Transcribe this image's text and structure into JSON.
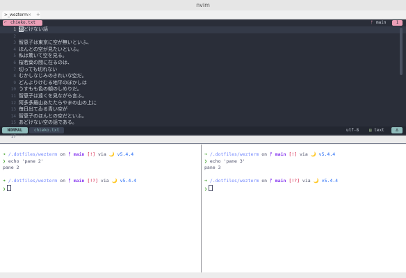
{
  "window": {
    "title": "nvim"
  },
  "tabs": [
    {
      "icon": ">_",
      "label": "wezterm",
      "close": "×"
    }
  ],
  "new_tab": "+",
  "nvim": {
    "buffer_tab": {
      "icon": "⌐",
      "name": "chieko.txt"
    },
    "git_branch": {
      "icon": "ᚠ",
      "name": "main"
    },
    "tab_number": "1",
    "lines": [
      {
        "n": "1",
        "text": "あどけない話",
        "current": true
      },
      {
        "n": "2",
        "text": ""
      },
      {
        "n": "3",
        "text": "智恵子は東京に空が無いといふ、"
      },
      {
        "n": "4",
        "text": "ほんとの空が見たいといふ。"
      },
      {
        "n": "5",
        "text": "私は驚いて空を見る。"
      },
      {
        "n": "6",
        "text": "桜若葉の間に在るのは、"
      },
      {
        "n": "7",
        "text": "切っても切れない"
      },
      {
        "n": "8",
        "text": "むかしなじみのきれいな空だ。"
      },
      {
        "n": "9",
        "text": "どんよりけむる地平のぼかしは"
      },
      {
        "n": "10",
        "text": "うすもも色の朝のしめりだ。"
      },
      {
        "n": "11",
        "text": "智恵子は遠くを見ながら言ふ。"
      },
      {
        "n": "12",
        "text": "阿多多羅山あたたらやまの山の上に"
      },
      {
        "n": "13",
        "text": "毎日出てゐる青い空が"
      },
      {
        "n": "14",
        "text": "智恵子のほんとの空だといふ。"
      },
      {
        "n": "15",
        "text": "あどけない空の話である。"
      },
      {
        "n": "16",
        "text": ""
      },
      {
        "n": "17",
        "text": "---"
      }
    ],
    "status": {
      "mode": "NORMAL",
      "file": "chieko.txt",
      "encoding": "utf-8",
      "filetype_icon": "▤",
      "filetype": "text",
      "right_icon": "∆"
    }
  },
  "panes": {
    "left": {
      "lines": [
        {
          "arrow": "➜",
          "dir": "/.dotfiles/wezterm",
          "on": " on ",
          "branch_icon": "ᚠ",
          "branch": " main",
          "git_status": " [!]",
          "via": " via ",
          "runtime_icon": "🌙",
          "version": " v5.4.4"
        },
        {
          "prompt": "❯",
          "cmd": " echo 'pane 2'"
        },
        {
          "output": "pane 2"
        },
        {
          "arrow": "➜",
          "dir": "/.dotfiles/wezterm",
          "on": " on ",
          "branch_icon": "ᚠ",
          "branch": " main",
          "git_status": " [!?]",
          "via": " via ",
          "runtime_icon": "🌙",
          "version": " v5.4.4"
        },
        {
          "prompt": "❯"
        }
      ]
    },
    "right": {
      "lines": [
        {
          "arrow": "➜",
          "dir": "/.dotfiles/wezterm",
          "on": " on ",
          "branch_icon": "ᚠ",
          "branch": " main",
          "git_status": " [!]",
          "via": " via ",
          "runtime_icon": "🌙",
          "version": " v5.4.4"
        },
        {
          "prompt": "❯",
          "cmd": " echo 'pane 3'"
        },
        {
          "output": "pane 3"
        },
        {
          "arrow": "➜",
          "dir": "/.dotfiles/wezterm",
          "on": " on ",
          "branch_icon": "ᚠ",
          "branch": " main",
          "git_status": " [!?]",
          "via": " via ",
          "runtime_icon": "🌙",
          "version": " v5.4.4"
        },
        {
          "prompt": "❯"
        }
      ]
    }
  },
  "colors": {
    "nvim_bg": "#2a2e39",
    "accent_pink": "#ec9fb7",
    "mode_teal": "#8fbcbb",
    "pane_bg": "#ffffff",
    "path_blue": "#7287fd",
    "branch_purple": "#8839ef"
  }
}
